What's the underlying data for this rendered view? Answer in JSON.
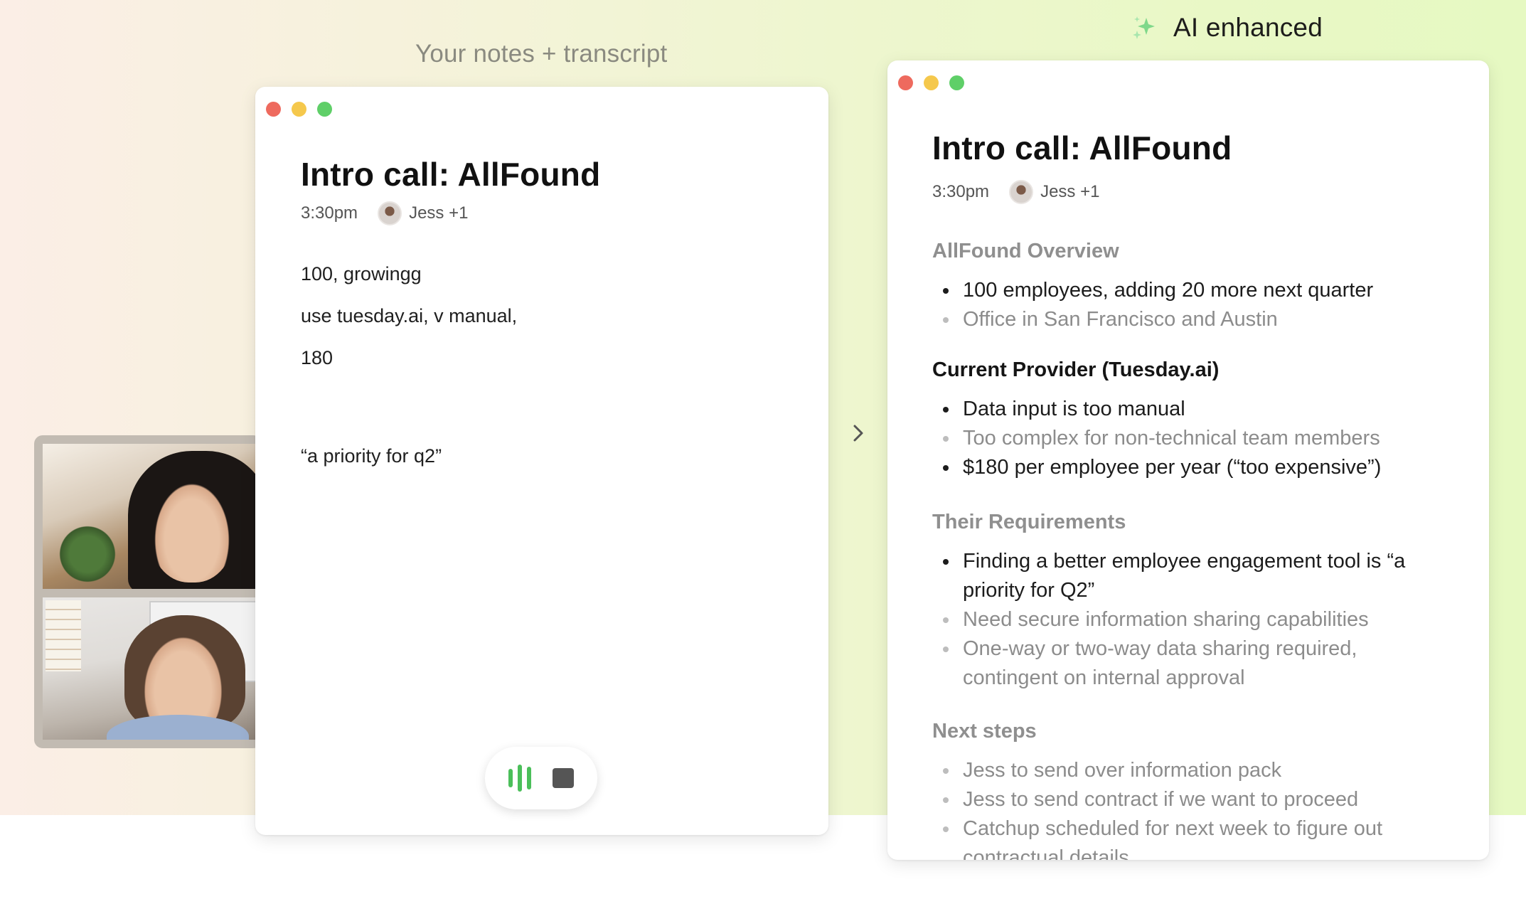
{
  "labels": {
    "left": "Your notes + transcript",
    "right": "AI enhanced"
  },
  "colors": {
    "accent_green": "#4bbf5a",
    "dot_red": "#ee6a5e",
    "dot_yellow": "#f5c84c",
    "dot_green": "#5fcf68"
  },
  "left_window": {
    "title": "Intro call: AllFound",
    "time": "3:30pm",
    "attendees": "Jess +1",
    "notes": [
      "100, growingg",
      "use tuesday.ai, v manual,",
      "180",
      "“a priority for q2”"
    ],
    "controls": {
      "audio_icon": "audio-wave-icon",
      "stop_icon": "stop-icon"
    }
  },
  "video": {
    "participants": [
      "participant-1",
      "participant-2"
    ]
  },
  "right_window": {
    "title": "Intro call: AllFound",
    "time": "3:30pm",
    "attendees": "Jess +1",
    "sections": [
      {
        "heading": "AllFound Overview",
        "items": [
          "100 employees, adding 20 more next quarter",
          "Office in San Francisco and Austin"
        ]
      },
      {
        "heading": "Current Provider (Tuesday.ai)",
        "items": [
          "Data input is too manual",
          "Too complex for non-technical team members",
          "$180 per employee per year (“too expensive”)"
        ]
      },
      {
        "heading": "Their Requirements",
        "items": [
          "Finding a better employee engagement tool is “a priority for Q2”",
          "Need secure information sharing capabilities",
          "One-way or two-way data sharing required, contingent on internal approval"
        ]
      },
      {
        "heading": "Next steps",
        "items": [
          "Jess to send over information pack",
          "Jess to send contract if we want to proceed",
          "Catchup scheduled for next week to figure out contractual details"
        ]
      }
    ]
  }
}
